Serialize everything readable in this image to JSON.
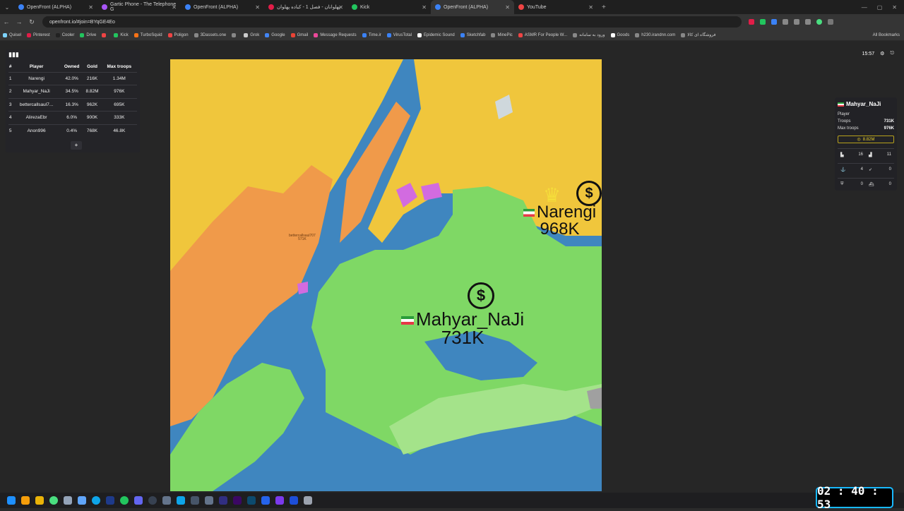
{
  "browser": {
    "tabs": [
      {
        "label": "OpenFront (ALPHA)",
        "color": "#3b82f6"
      },
      {
        "label": "Gartic Phone - The Telephone G",
        "color": "#a855f7"
      },
      {
        "label": "OpenFront (ALPHA)",
        "color": "#3b82f6"
      },
      {
        "label": "پهلوانان - فصل 1 - کباده پهلوان",
        "color": "#e11d48"
      },
      {
        "label": "Kick",
        "color": "#22c55e"
      },
      {
        "label": "OpenFront (ALPHA)",
        "color": "#3b82f6",
        "active": true
      },
      {
        "label": "YouTube",
        "color": "#ef4444"
      }
    ],
    "url": "openfront.io/#join=BYqGE4Eo",
    "bookmarks": [
      {
        "label": "Quisel",
        "color": "#7dd3fc"
      },
      {
        "label": "Pinterest",
        "color": "#e11d48"
      },
      {
        "label": "Cooler",
        "color": "#222"
      },
      {
        "label": "Drive",
        "color": "#22c55e"
      },
      {
        "label": "",
        "color": "#ef4444"
      },
      {
        "label": "Kick",
        "color": "#22c55e"
      },
      {
        "label": "TurboSquid",
        "color": "#f97316"
      },
      {
        "label": "Poligon",
        "color": "#ef4444"
      },
      {
        "label": "3Dassets.one",
        "color": "#888"
      },
      {
        "label": "",
        "color": "#888"
      },
      {
        "label": "Grok",
        "color": "#ccc"
      },
      {
        "label": "Google",
        "color": "#4285f4"
      },
      {
        "label": "Gmail",
        "color": "#ea4335"
      },
      {
        "label": "Message Requests",
        "color": "#ec4899"
      },
      {
        "label": "Time.ir",
        "color": "#3b82f6"
      },
      {
        "label": "VirusTotal",
        "color": "#3b82f6"
      },
      {
        "label": "Epidemic Sound",
        "color": "#fff"
      },
      {
        "label": "Sketchfab",
        "color": "#3b82f6"
      },
      {
        "label": "MinePic",
        "color": "#888"
      },
      {
        "label": "ASMR For People W...",
        "color": "#ef4444"
      },
      {
        "label": "ورود به سامانه",
        "color": "#888"
      },
      {
        "label": "Goods",
        "color": "#fff"
      },
      {
        "label": "h230.irandnn.com",
        "color": "#888"
      },
      {
        "label": "فروشگاه ای کالا",
        "color": "#888"
      }
    ],
    "all_bookmarks": "All Bookmarks"
  },
  "leaderboard": {
    "headers": [
      "#",
      "Player",
      "Owned",
      "Gold",
      "Max troops"
    ],
    "rows": [
      {
        "rank": "1",
        "player": "Narengi",
        "owned": "42.0%",
        "gold": "216K",
        "max_troops": "1.34M"
      },
      {
        "rank": "2",
        "player": "Mahyar_NaJi",
        "owned": "34.5%",
        "gold": "8.82M",
        "max_troops": "976K"
      },
      {
        "rank": "3",
        "player": "bettercallsaul7...",
        "owned": "16.3%",
        "gold": "962K",
        "max_troops": "695K"
      },
      {
        "rank": "4",
        "player": "AlirezaEbr",
        "owned": "6.0%",
        "gold": "900K",
        "max_troops": "333K"
      },
      {
        "rank": "5",
        "player": "Anon996",
        "owned": "0.4%",
        "gold": "768K",
        "max_troops": "46.8K"
      }
    ],
    "add_label": "+"
  },
  "top_right": {
    "time": "15:57"
  },
  "player_panel": {
    "name": "Mahyar_NaJi",
    "type_label": "Player",
    "troops_label": "Troops",
    "troops_value": "731K",
    "max_troops_label": "Max troops",
    "max_troops_value": "976K",
    "gold": "8.82M",
    "stats": [
      {
        "icon": "city-icon",
        "value": "16"
      },
      {
        "icon": "factory-icon",
        "value": "11"
      },
      {
        "icon": "port-anchor-icon",
        "value": "4"
      },
      {
        "icon": "missile-silo-icon",
        "value": "0"
      },
      {
        "icon": "defense-post-icon",
        "value": "0"
      },
      {
        "icon": "warship-icon",
        "value": "0"
      }
    ]
  },
  "map": {
    "labels": [
      {
        "name": "Narengi",
        "troops": "968K"
      },
      {
        "name": "Mahyar_NaJi",
        "troops": "731K"
      },
      {
        "name": "bettercallsaul707",
        "troops": "571K"
      }
    ],
    "colors": {
      "water": "#3f86bf",
      "yellow": "#f0c63c",
      "orange": "#f09a4a",
      "green": "#7fd865",
      "light_green": "#a4e38a",
      "magenta": "#d26be0"
    }
  },
  "stream_timer": "02 : 40 : 53"
}
